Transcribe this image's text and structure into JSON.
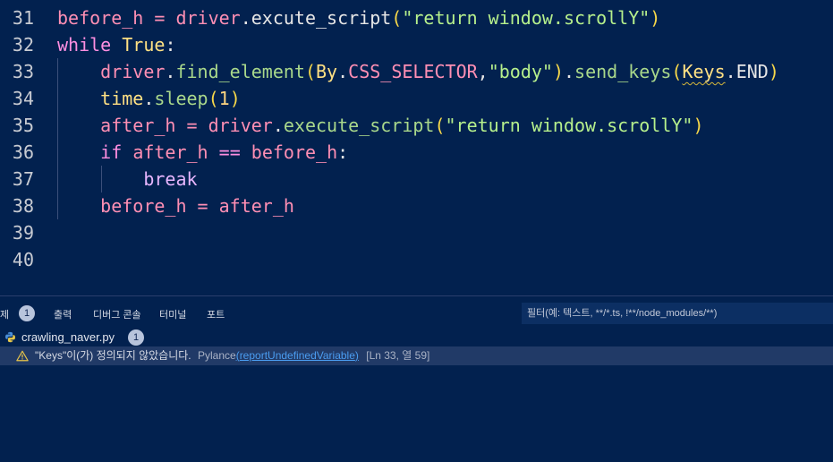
{
  "editor": {
    "lines": [
      {
        "num": "31",
        "tokens": [
          {
            "t": "before_h",
            "c": "t-var"
          },
          {
            "t": " = ",
            "c": "t-op"
          },
          {
            "t": "driver",
            "c": "t-var"
          },
          {
            "t": ".",
            "c": "t-white"
          },
          {
            "t": "excute_script",
            "c": "t-white"
          },
          {
            "t": "(",
            "c": "t-paren"
          },
          {
            "t": "\"return window.scrollY\"",
            "c": "t-str"
          },
          {
            "t": ")",
            "c": "t-paren"
          }
        ]
      },
      {
        "num": "32",
        "tokens": [
          {
            "t": "while",
            "c": "t-kw"
          },
          {
            "t": " ",
            "c": "t-white"
          },
          {
            "t": "True",
            "c": "t-cls"
          },
          {
            "t": ":",
            "c": "t-white"
          }
        ]
      },
      {
        "num": "33",
        "tokens": [
          {
            "t": "    ",
            "c": "t-white"
          },
          {
            "t": "driver",
            "c": "t-var"
          },
          {
            "t": ".",
            "c": "t-white"
          },
          {
            "t": "find_element",
            "c": "t-fn"
          },
          {
            "t": "(",
            "c": "t-paren"
          },
          {
            "t": "By",
            "c": "t-cls"
          },
          {
            "t": ".",
            "c": "t-white"
          },
          {
            "t": "CSS_SELECTOR",
            "c": "t-const"
          },
          {
            "t": ",",
            "c": "t-white"
          },
          {
            "t": "\"body\"",
            "c": "t-str"
          },
          {
            "t": ")",
            "c": "t-paren"
          },
          {
            "t": ".",
            "c": "t-white"
          },
          {
            "t": "send_keys",
            "c": "t-fn"
          },
          {
            "t": "(",
            "c": "t-paren"
          },
          {
            "t": "Keys",
            "c": "t-cls squiggle"
          },
          {
            "t": ".",
            "c": "t-white"
          },
          {
            "t": "END",
            "c": "t-white"
          },
          {
            "t": ")",
            "c": "t-paren"
          }
        ]
      },
      {
        "num": "34",
        "tokens": [
          {
            "t": "    ",
            "c": "t-white"
          },
          {
            "t": "time",
            "c": "t-cls"
          },
          {
            "t": ".",
            "c": "t-white"
          },
          {
            "t": "sleep",
            "c": "t-fn"
          },
          {
            "t": "(",
            "c": "t-paren"
          },
          {
            "t": "1",
            "c": "t-num"
          },
          {
            "t": ")",
            "c": "t-paren"
          }
        ]
      },
      {
        "num": "35",
        "tokens": [
          {
            "t": "    ",
            "c": "t-white"
          },
          {
            "t": "after_h",
            "c": "t-var"
          },
          {
            "t": " = ",
            "c": "t-op"
          },
          {
            "t": "driver",
            "c": "t-var"
          },
          {
            "t": ".",
            "c": "t-white"
          },
          {
            "t": "execute_script",
            "c": "t-fn"
          },
          {
            "t": "(",
            "c": "t-paren"
          },
          {
            "t": "\"return window.scrollY\"",
            "c": "t-str"
          },
          {
            "t": ")",
            "c": "t-paren"
          }
        ]
      },
      {
        "num": "36",
        "tokens": [
          {
            "t": "    ",
            "c": "t-white"
          },
          {
            "t": "if",
            "c": "t-kw"
          },
          {
            "t": " ",
            "c": "t-white"
          },
          {
            "t": "after_h",
            "c": "t-var"
          },
          {
            "t": " == ",
            "c": "t-kw"
          },
          {
            "t": "before_h",
            "c": "t-var"
          },
          {
            "t": ":",
            "c": "t-white"
          }
        ]
      },
      {
        "num": "37",
        "tokens": [
          {
            "t": "        ",
            "c": "t-white"
          },
          {
            "t": "break",
            "c": "t-kw2"
          }
        ]
      },
      {
        "num": "38",
        "tokens": [
          {
            "t": "    ",
            "c": "t-white"
          },
          {
            "t": "before_h",
            "c": "t-var"
          },
          {
            "t": " = ",
            "c": "t-op"
          },
          {
            "t": "after_h",
            "c": "t-var"
          }
        ]
      },
      {
        "num": "39",
        "tokens": []
      },
      {
        "num": "40",
        "tokens": []
      }
    ]
  },
  "panel": {
    "tabs": [
      {
        "label": "제",
        "badge": "1"
      },
      {
        "label": "출력"
      },
      {
        "label": "디버그 콘솔"
      },
      {
        "label": "터미널"
      },
      {
        "label": "포트"
      }
    ],
    "filter_placeholder": "필터(예: 텍스트, **/*.ts, !**/node_modules/**)"
  },
  "problems": {
    "file_name": "crawling_naver.py",
    "file_count": "1",
    "message": "\"Keys\"이(가) 정의되지 않았습니다.",
    "source": "Pylance",
    "rule_open": "(",
    "rule": "reportUndefinedVariable",
    "rule_close": ")",
    "location": "[Ln 33, 열 59]"
  },
  "colors": {
    "background": "#02214f",
    "selected_row": "#213a67",
    "link": "#4a9cf0",
    "warning": "#e6c34a"
  }
}
